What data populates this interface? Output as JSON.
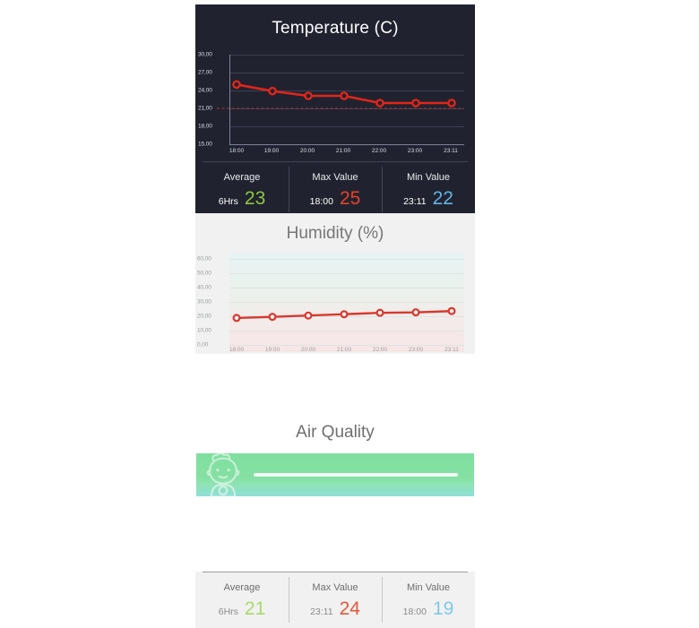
{
  "temperature": {
    "title": "Temperature (C)",
    "stats": {
      "average": {
        "label": "Average",
        "sub": "6Hrs",
        "value": "23",
        "color": "#8ec73f"
      },
      "max": {
        "label": "Max Value",
        "sub": "18:00",
        "value": "25",
        "color": "#e8402a"
      },
      "min": {
        "label": "Min Value",
        "sub": "23:11",
        "value": "22",
        "color": "#63b3e3"
      }
    }
  },
  "humidity": {
    "title": "Humidity (%)",
    "stats": {
      "average": {
        "label": "Average",
        "sub": "6Hrs",
        "value": "21",
        "color": "#a9d96a"
      },
      "max": {
        "label": "Max Value",
        "sub": "23:11",
        "value": "24",
        "color": "#e8573a"
      },
      "min": {
        "label": "Min Value",
        "sub": "18:00",
        "value": "19",
        "color": "#7fc9ea"
      }
    }
  },
  "air_quality": {
    "title": "Air Quality",
    "icon": "baby-face-icon",
    "bar_colors": {
      "start": "#7fdfa0",
      "end": "#8fdfd8"
    }
  },
  "chart_data": [
    {
      "type": "line",
      "title": "Temperature (C)",
      "xlabel": "",
      "ylabel": "",
      "x": [
        "18:00",
        "19:00",
        "20:00",
        "21:00",
        "22:00",
        "23:00",
        "23:11"
      ],
      "tick_labels_y": [
        "30,00",
        "27,00",
        "24,00",
        "21,00",
        "18,00",
        "15,00"
      ],
      "ylim": [
        15,
        30
      ],
      "ytick_values": [
        30,
        27,
        24,
        21,
        18,
        15
      ],
      "grid": true,
      "legend": "none",
      "series": [
        {
          "name": "Temperature",
          "values": [
            25.0,
            23.9,
            23.1,
            23.1,
            21.9,
            21.9,
            21.9
          ],
          "color": "#e0251b",
          "marker": "open-circle"
        }
      ],
      "annotations": [
        {
          "type": "hline",
          "value": 21,
          "style": "dashed",
          "color": "#b3332c"
        }
      ]
    },
    {
      "type": "line",
      "title": "Humidity (%)",
      "xlabel": "",
      "ylabel": "",
      "x": [
        "18:00",
        "19:00",
        "20:00",
        "21:00",
        "22:00",
        "23:00",
        "23:11"
      ],
      "tick_labels_y": [
        "60,00",
        "50,00",
        "40,00",
        "30,00",
        "20,00",
        "10,00",
        "0,00"
      ],
      "ylim": [
        0,
        60
      ],
      "ytick_values": [
        60,
        50,
        40,
        30,
        20,
        10,
        0
      ],
      "grid": true,
      "legend": "none",
      "series": [
        {
          "name": "Humidity",
          "values": [
            18.8,
            19.6,
            20.5,
            21.4,
            22.4,
            22.7,
            23.6
          ],
          "color": "#d8382e",
          "marker": "open-circle"
        }
      ],
      "background_gradient": [
        "#e7f2f4",
        "#e9f2ec",
        "#f2ecea",
        "#f7e6e6"
      ]
    }
  ]
}
